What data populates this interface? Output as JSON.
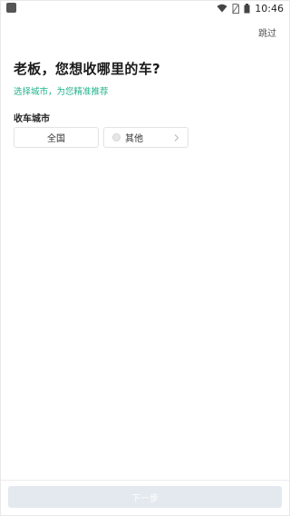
{
  "status_bar": {
    "time": "10:46",
    "icons": [
      "app-icon",
      "wifi-icon",
      "no-sim-icon",
      "battery-icon"
    ]
  },
  "header": {
    "skip_label": "跳过"
  },
  "main": {
    "title": "老板，您想收哪里的车?",
    "subtitle": "选择城市，为您精准推荐",
    "section_label": "收车城市",
    "options": [
      {
        "label": "全国",
        "icon": null
      },
      {
        "label": "其他",
        "icon": "radio-icon",
        "trailing_icon": "chevron-right-icon"
      }
    ]
  },
  "footer": {
    "next_label": "下一步",
    "next_enabled": false
  },
  "colors": {
    "accent": "#21b38a",
    "button_disabled_bg": "#e3e9ef",
    "title_text": "#1a1a1a"
  }
}
